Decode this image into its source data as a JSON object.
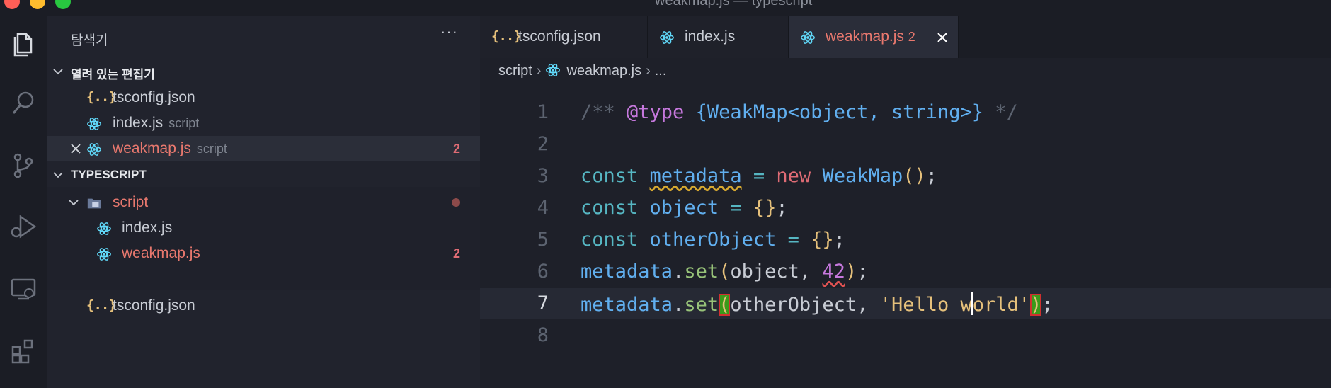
{
  "window": {
    "title": "weakmap.js — typescript"
  },
  "colors": {
    "close": "#ff5f57",
    "minimize": "#febc2e",
    "maximize": "#28c840",
    "accent_error": "#e06c75",
    "react_icon": "#61dafb",
    "json_icon": "#e5c07b"
  },
  "activity_bar": {
    "items": [
      {
        "icon": "files-icon"
      },
      {
        "icon": "search-icon"
      },
      {
        "icon": "source-control-icon"
      },
      {
        "icon": "run-debug-icon"
      },
      {
        "icon": "remote-explorer-icon"
      },
      {
        "icon": "extensions-icon"
      }
    ]
  },
  "sidebar": {
    "title": "탐색기",
    "more": "···",
    "open_editors": {
      "label": "열려 있는 편집기",
      "items": [
        {
          "name": "tsconfig.json",
          "desc": "",
          "badge": "",
          "icon": "json-icon"
        },
        {
          "name": "index.js",
          "desc": "script",
          "badge": "",
          "icon": "react-icon"
        },
        {
          "name": "weakmap.js",
          "desc": "script",
          "badge": "2",
          "icon": "react-icon"
        }
      ]
    },
    "workspace": {
      "label": "TYPESCRIPT",
      "folder": "script",
      "children": [
        {
          "name": "index.js",
          "badge": ""
        },
        {
          "name": "weakmap.js",
          "badge": "2"
        }
      ],
      "root_file": "tsconfig.json"
    }
  },
  "tabs": [
    {
      "label": "tsconfig.json",
      "icon": "json-icon",
      "badge": ""
    },
    {
      "label": "index.js",
      "icon": "react-icon",
      "badge": ""
    },
    {
      "label": "weakmap.js",
      "icon": "react-icon",
      "badge": "2",
      "active": true
    }
  ],
  "breadcrumb": {
    "folder": "script",
    "file": "weakmap.js",
    "tail": "..."
  },
  "editor": {
    "current_line": 7,
    "lines": [
      {
        "n": "1"
      },
      {
        "n": "2"
      },
      {
        "n": "3"
      },
      {
        "n": "4"
      },
      {
        "n": "5"
      },
      {
        "n": "6"
      },
      {
        "n": "7"
      },
      {
        "n": "8"
      }
    ],
    "code": {
      "l1": {
        "open": "/** ",
        "tag": "@type",
        "type": "{WeakMap<object, string>}",
        "close": " */"
      },
      "l3": {
        "kw": "const",
        "var": "metadata",
        "op": "=",
        "new": "new",
        "cls": "WeakMap",
        "parens": "()",
        "semi": ";"
      },
      "l4": {
        "kw": "const",
        "var": "object",
        "op": "=",
        "val": "{}",
        "semi": ";"
      },
      "l5": {
        "kw": "const",
        "var": "otherObject",
        "op": "=",
        "val": "{}",
        "semi": ";"
      },
      "l6": {
        "obj": "metadata",
        "dot": ".",
        "fn": "set",
        "open": "(",
        "arg1": "object",
        "comma": ", ",
        "arg2": "42",
        "close": ")",
        "semi": ";"
      },
      "l7": {
        "obj": "metadata",
        "dot": ".",
        "fn": "set",
        "open": "(",
        "arg1": "otherObject",
        "comma": ", ",
        "str_a": "'Hello w",
        "str_b": "orld'",
        "close": ")",
        "semi": ";"
      }
    }
  }
}
